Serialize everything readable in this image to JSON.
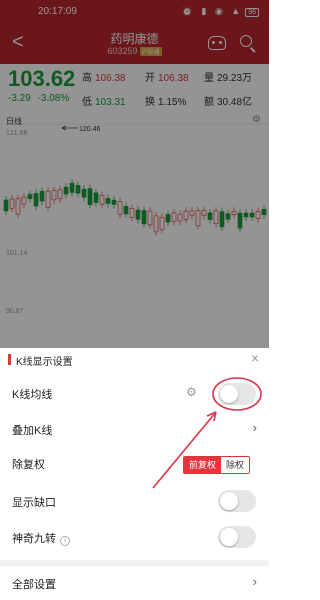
{
  "status": {
    "time": "20:17:09",
    "battery": "96"
  },
  "header": {
    "back_glyph": "<",
    "title": "药明康德",
    "code": "603259",
    "tag": "沪股通"
  },
  "quote": {
    "price": "103.62",
    "change": "-3.29",
    "change_pct": "-3.08%",
    "high_label": "高",
    "high": "106.38",
    "open_label": "开",
    "open": "106.38",
    "volume_label": "量",
    "volume": "29.23万",
    "low_label": "低",
    "low": "103.31",
    "turnover_label": "换",
    "turnover": "1.15%",
    "amount_label": "额",
    "amount": "30.48亿"
  },
  "chart": {
    "period": "日线",
    "y_labels": [
      "121.68",
      "101.14",
      "90.87"
    ],
    "max_mark": "120.46"
  },
  "sheet": {
    "title": "K线显示设置",
    "close_glyph": "×",
    "rows": [
      {
        "label": "K线均线"
      },
      {
        "label": "叠加K线"
      },
      {
        "label": "除复权"
      },
      {
        "label": "显示缺口"
      },
      {
        "label": "神奇九转"
      },
      {
        "label": "全部设置"
      }
    ],
    "seg": {
      "active": "前复权",
      "inactive": "除权"
    },
    "info_glyph": "i"
  }
}
